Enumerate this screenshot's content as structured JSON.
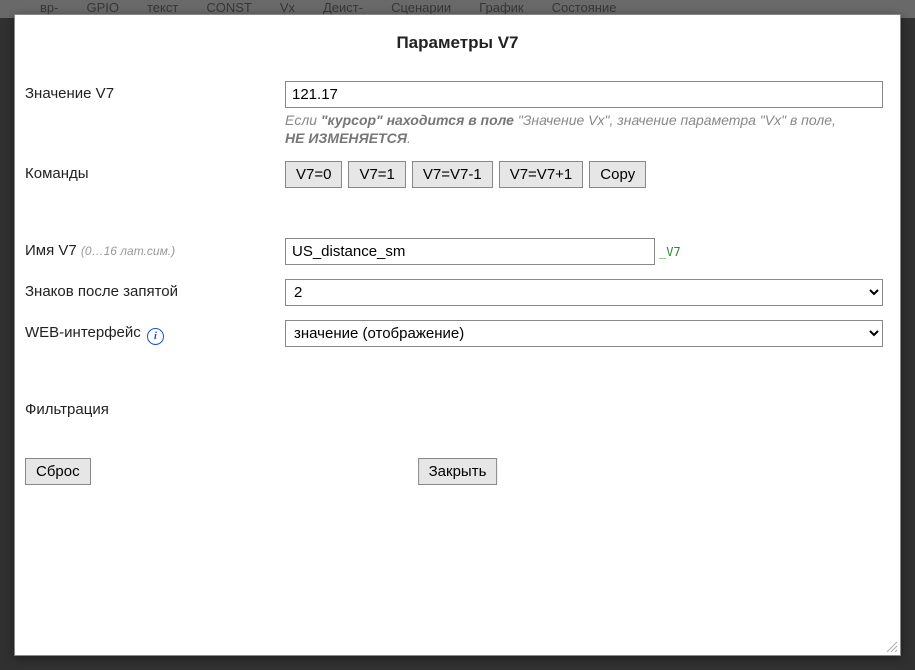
{
  "bg_tabs": [
    "вр-",
    "GPIO",
    "текст",
    "CONST",
    "Vx",
    "Деист-",
    "Сценарии",
    "График",
    "Состояние"
  ],
  "dialog": {
    "title": "Параметры V7",
    "value": {
      "label": "Значение V7",
      "current": "121.17",
      "hint_prefix": "Если ",
      "hint_bold1": "\"курсор\" находится в поле ",
      "hint_mid": "\"Значение Vx\", значение параметра \"Vx\" в поле, ",
      "hint_bold2": "НЕ ИЗМЕНЯЕТСЯ",
      "hint_end": "."
    },
    "commands": {
      "label": "Команды",
      "btn_zero": "V7=0",
      "btn_one": "V7=1",
      "btn_dec": "V7=V7-1",
      "btn_inc": "V7=V7+1",
      "btn_copy": "Copy"
    },
    "name": {
      "label_main": "Имя V7 ",
      "label_sub": "(0…16 лат.сим.)",
      "value": "US_distance_sm",
      "suffix": "_V7"
    },
    "decimals": {
      "label": "Знаков после запятой",
      "value": "2"
    },
    "web": {
      "label": "WEB-интерфейс",
      "value": "значение (отображение)"
    },
    "filter": {
      "label": "Фильтрация"
    },
    "buttons": {
      "reset": "Сброс",
      "close": "Закрыть"
    }
  }
}
